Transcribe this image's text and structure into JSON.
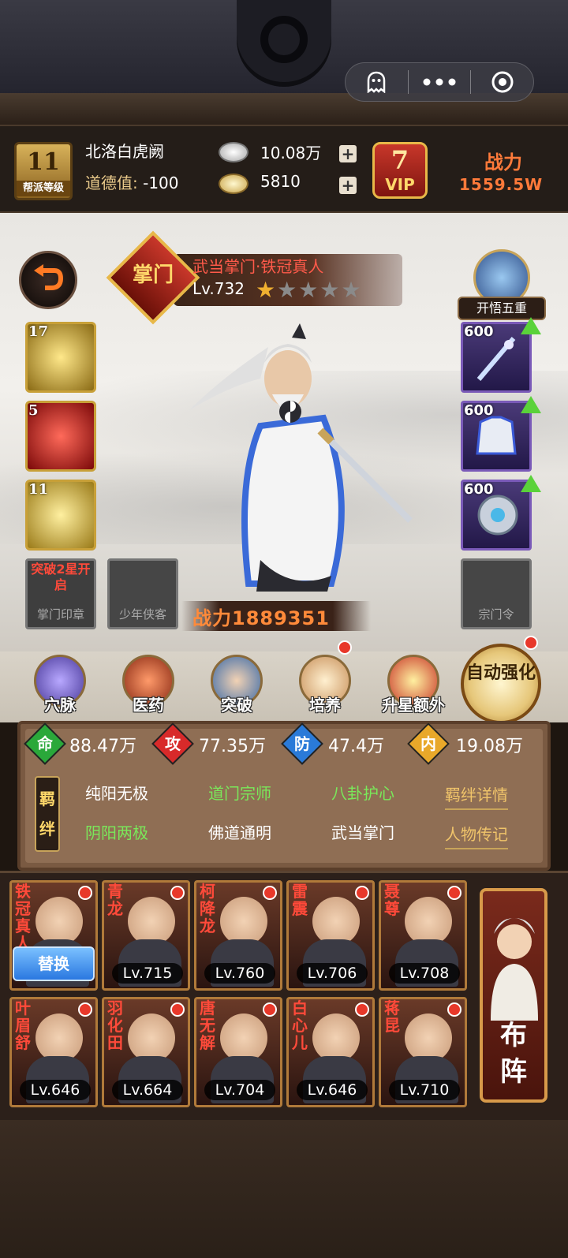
{
  "header": {
    "guild_level": "11",
    "guild_level_label": "帮派等级",
    "guild_name": "北洛白虎阙",
    "morality_label": "道德值:",
    "morality_value": "-100",
    "silver": "10.08万",
    "gold": "5810",
    "plus": "+",
    "vip_level": "7",
    "vip_label": "VIP",
    "power_label": "战力",
    "power_value": "1559.5W"
  },
  "hero": {
    "rank_badge": "掌门",
    "title": "武当掌门·铁冠真人",
    "level": "Lv.732",
    "stars_filled": 1,
    "stars_total": 5,
    "awaken_label": "开悟五重",
    "power": "战力1889351",
    "colors": {
      "robe": "#f4f4f4",
      "trim": "#3a6ad8",
      "hair": "#dcdcdc"
    }
  },
  "skills": [
    {
      "level": "17",
      "icon": "tai-chi-skill-icon"
    },
    {
      "level": "5",
      "icon": "red-sword-skill-icon"
    },
    {
      "level": "11",
      "icon": "golden-strike-skill-icon"
    }
  ],
  "equipment": [
    {
      "level": "600",
      "icon": "sword-equip-icon"
    },
    {
      "level": "600",
      "icon": "armor-equip-icon"
    },
    {
      "level": "600",
      "icon": "bagua-equip-icon"
    }
  ],
  "slots": {
    "seal_note": "突破2星开启",
    "seal_label": "掌门印章",
    "youth_label": "少年侠客",
    "order_label": "宗门令"
  },
  "functions": [
    {
      "label": "穴脉",
      "icon": "meridian-icon",
      "color": "#6a5ac8"
    },
    {
      "label": "医药",
      "icon": "medicine-icon",
      "color": "#c84a2a"
    },
    {
      "label": "突破",
      "icon": "breakthrough-icon",
      "color": "#3a7ac8"
    },
    {
      "label": "培养",
      "icon": "cultivate-icon",
      "color": "#d8a86a"
    },
    {
      "label": "升星额外",
      "icon": "star-up-icon",
      "color": "#e8c85a"
    }
  ],
  "auto_btn": "自动强化",
  "stats": [
    {
      "icon": "命",
      "value": "88.47万",
      "color": "#2aa83a"
    },
    {
      "icon": "攻",
      "value": "77.35万",
      "color": "#d82a2a"
    },
    {
      "icon": "防",
      "value": "47.4万",
      "color": "#2a7ad8"
    },
    {
      "icon": "内",
      "value": "19.08万",
      "color": "#e8a82a"
    }
  ],
  "bond_badge": "羁绊",
  "bonds": [
    {
      "text": "纯阳无极",
      "active": false
    },
    {
      "text": "道门宗师",
      "active": true
    },
    {
      "text": "八卦护心",
      "active": true
    },
    {
      "text": "阴阳两极",
      "active": true
    },
    {
      "text": "佛道通明",
      "active": false
    },
    {
      "text": "武当掌门",
      "active": false
    }
  ],
  "bond_detail": "羁绊详情",
  "biography": "人物传记",
  "roster": [
    {
      "name": "铁冠真人",
      "level": ""
    },
    {
      "name": "青龙",
      "level": "Lv.715"
    },
    {
      "name": "柯降龙",
      "level": "Lv.760"
    },
    {
      "name": "雷震",
      "level": "Lv.706"
    },
    {
      "name": "聂尊",
      "level": "Lv.708"
    },
    {
      "name": "叶眉舒",
      "level": "Lv.646"
    },
    {
      "name": "羽化田",
      "level": "Lv.664"
    },
    {
      "name": "唐无解",
      "level": "Lv.704"
    },
    {
      "name": "白心儿",
      "level": "Lv.646"
    },
    {
      "name": "蒋昆",
      "level": "Lv.710"
    }
  ],
  "swap_btn": "替换",
  "formation_btn": "布阵"
}
